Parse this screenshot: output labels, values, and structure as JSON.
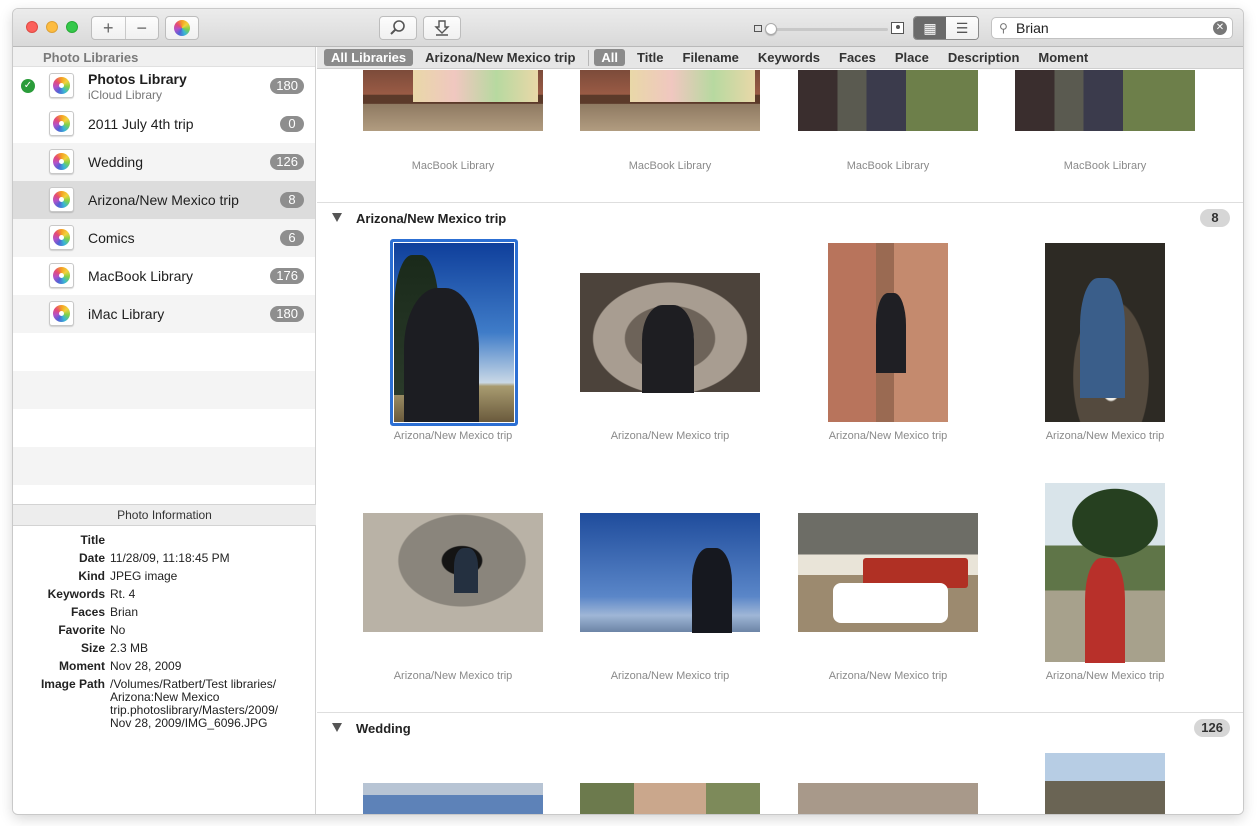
{
  "toolbar": {
    "add_label": "+",
    "remove_label": "−",
    "search_value": "Brian",
    "view_grid_label": "▦",
    "view_list_label": "☰",
    "photos_icon": "photos-app-icon",
    "inspect_icon": "magnifier-icon",
    "import_icon": "download-arrow-icon"
  },
  "sidebar": {
    "header": "Photo Libraries",
    "libraries": [
      {
        "name": "Photos Library",
        "subtitle": "iCloud Library",
        "count": "180",
        "active": true
      },
      {
        "name": "2011 July 4th trip",
        "count": "0"
      },
      {
        "name": "Wedding",
        "count": "126"
      },
      {
        "name": "Arizona/New Mexico trip",
        "count": "8",
        "selected": true
      },
      {
        "name": "Comics",
        "count": "6"
      },
      {
        "name": "MacBook Library",
        "count": "176"
      },
      {
        "name": "iMac Library",
        "count": "180"
      }
    ]
  },
  "info": {
    "header": "Photo Information",
    "rows": [
      {
        "key": "Title",
        "value": ""
      },
      {
        "key": "Date",
        "value": "11/28/09, 11:18:45 PM"
      },
      {
        "key": "Kind",
        "value": "JPEG image"
      },
      {
        "key": "Keywords",
        "value": "Rt. 4"
      },
      {
        "key": "Faces",
        "value": "Brian"
      },
      {
        "key": "Favorite",
        "value": "No"
      },
      {
        "key": "Size",
        "value": "2.3 MB"
      },
      {
        "key": "Moment",
        "value": "Nov 28, 2009"
      },
      {
        "key": "Image Path",
        "value": "/Volumes/Ratbert/Test libraries/ Arizona:New Mexico trip.photoslibrary/Masters/2009/ Nov 28, 2009/IMG_6096.JPG"
      }
    ]
  },
  "filters": {
    "scope": [
      "All Libraries",
      "Arizona/New Mexico trip"
    ],
    "fields": [
      "All",
      "Title",
      "Filename",
      "Keywords",
      "Faces",
      "Place",
      "Description",
      "Moment"
    ]
  },
  "sections": {
    "top_caption": "MacBook Library",
    "arizona": {
      "title": "Arizona/New Mexico trip",
      "count": "8",
      "caption": "Arizona/New Mexico trip"
    },
    "wedding": {
      "title": "Wedding",
      "count": "126"
    }
  },
  "colors": {
    "selection": "#2c6fd3",
    "badge": "#8e8e8e",
    "active_check": "#2a9c3a"
  }
}
